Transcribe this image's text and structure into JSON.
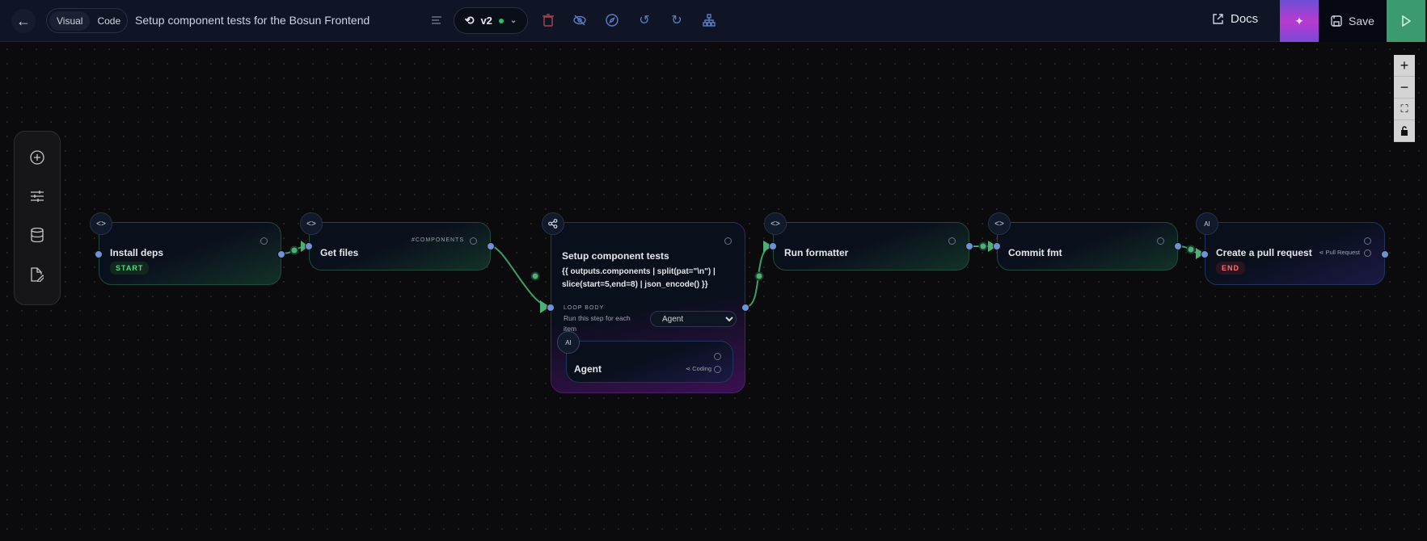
{
  "header": {
    "back_icon": "arrow-left-icon",
    "view_tabs": [
      "Visual",
      "Code"
    ],
    "active_tab": "Visual",
    "title": "Setup component tests for the Bosun Frontend",
    "version": "v2",
    "version_status_color": "#22c55e",
    "docs_label": "Docs",
    "save_label": "Save",
    "ai_gradient": [
      "#6d4fd6",
      "#b93ad0"
    ],
    "run_color": "#3b9a6e"
  },
  "zoom_controls": [
    "zoom-in",
    "zoom-out",
    "fit-view",
    "lock"
  ],
  "sidebar": {
    "items": [
      "add-node",
      "settings",
      "data",
      "edit-document"
    ]
  },
  "nodes": {
    "install": {
      "label": "Install deps",
      "badge": "START"
    },
    "getfiles": {
      "label": "Get files",
      "tag": "#COMPONENTS"
    },
    "loop": {
      "label": "Setup component tests",
      "expression": "{{ outputs.components | split(pat=\"\\n\") | slice(start=5,end=8) | json_encode() }}",
      "loop_heading": "LOOP BODY",
      "loop_desc": "Run this step for each item",
      "select_value": "Agent",
      "inner": {
        "label": "Agent",
        "tag": "Coding"
      }
    },
    "formatter": {
      "label": "Run formatter"
    },
    "commit": {
      "label": "Commit fmt"
    },
    "pr": {
      "label": "Create a pull request",
      "tag": "Pull Request",
      "badge": "END"
    }
  }
}
